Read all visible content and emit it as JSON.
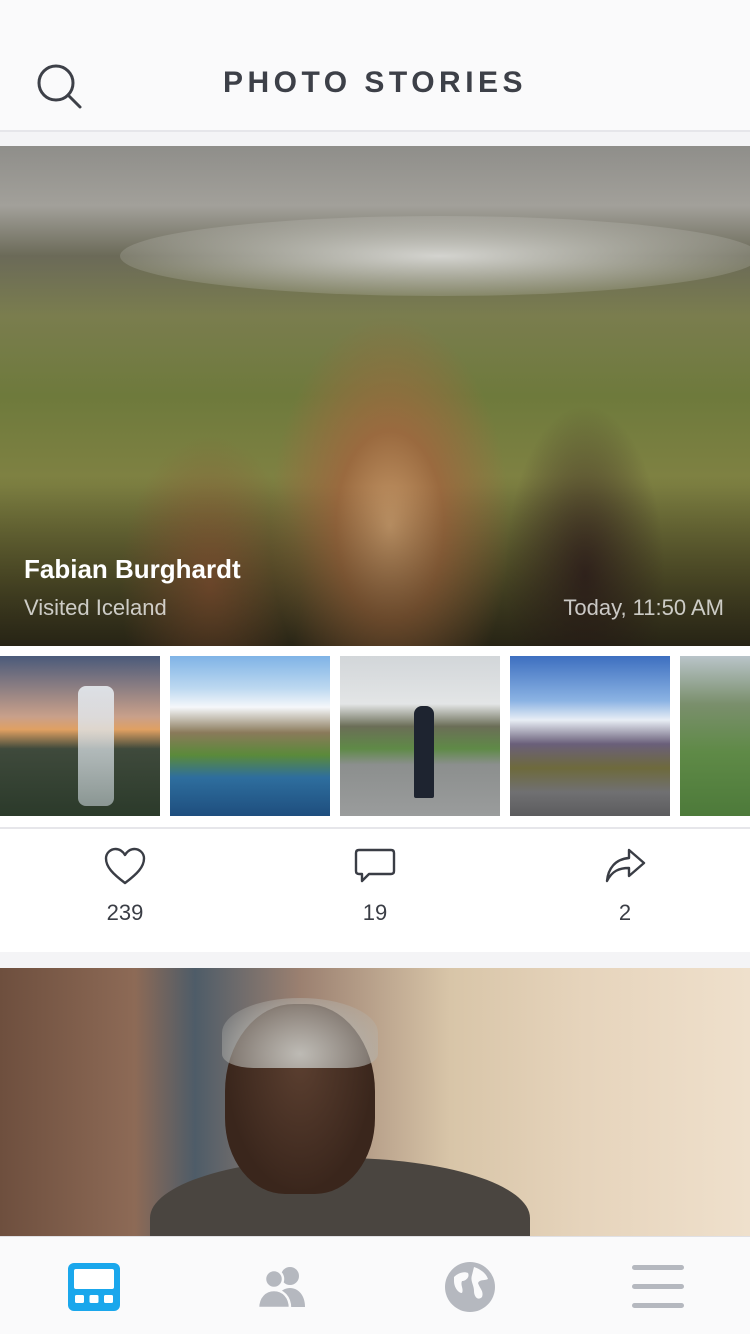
{
  "header": {
    "title": "PHOTO STORIES",
    "search_icon": "search-icon"
  },
  "story_1": {
    "author": "Fabian Burghardt",
    "subtitle": "Visited Iceland",
    "time": "Today, 11:50 AM",
    "hero_image": "icelandic-horses-photo",
    "thumbnails": [
      "waterfall-photo",
      "snowy-mountain-river-photo",
      "man-on-road-photo",
      "mountain-lake-road-photo",
      "green-hills-photo"
    ],
    "actions": {
      "likes": "239",
      "comments": "19",
      "shares": "2"
    }
  },
  "story_2": {
    "hero_image": "elderly-man-street-photo"
  },
  "tabbar": {
    "items": [
      "feed-icon",
      "people-icon",
      "globe-icon",
      "menu-icon"
    ],
    "active": "feed-icon"
  },
  "colors": {
    "accent": "#1aa7ec",
    "inactive_icon": "#b5b8bf",
    "text": "#3a3d45"
  }
}
